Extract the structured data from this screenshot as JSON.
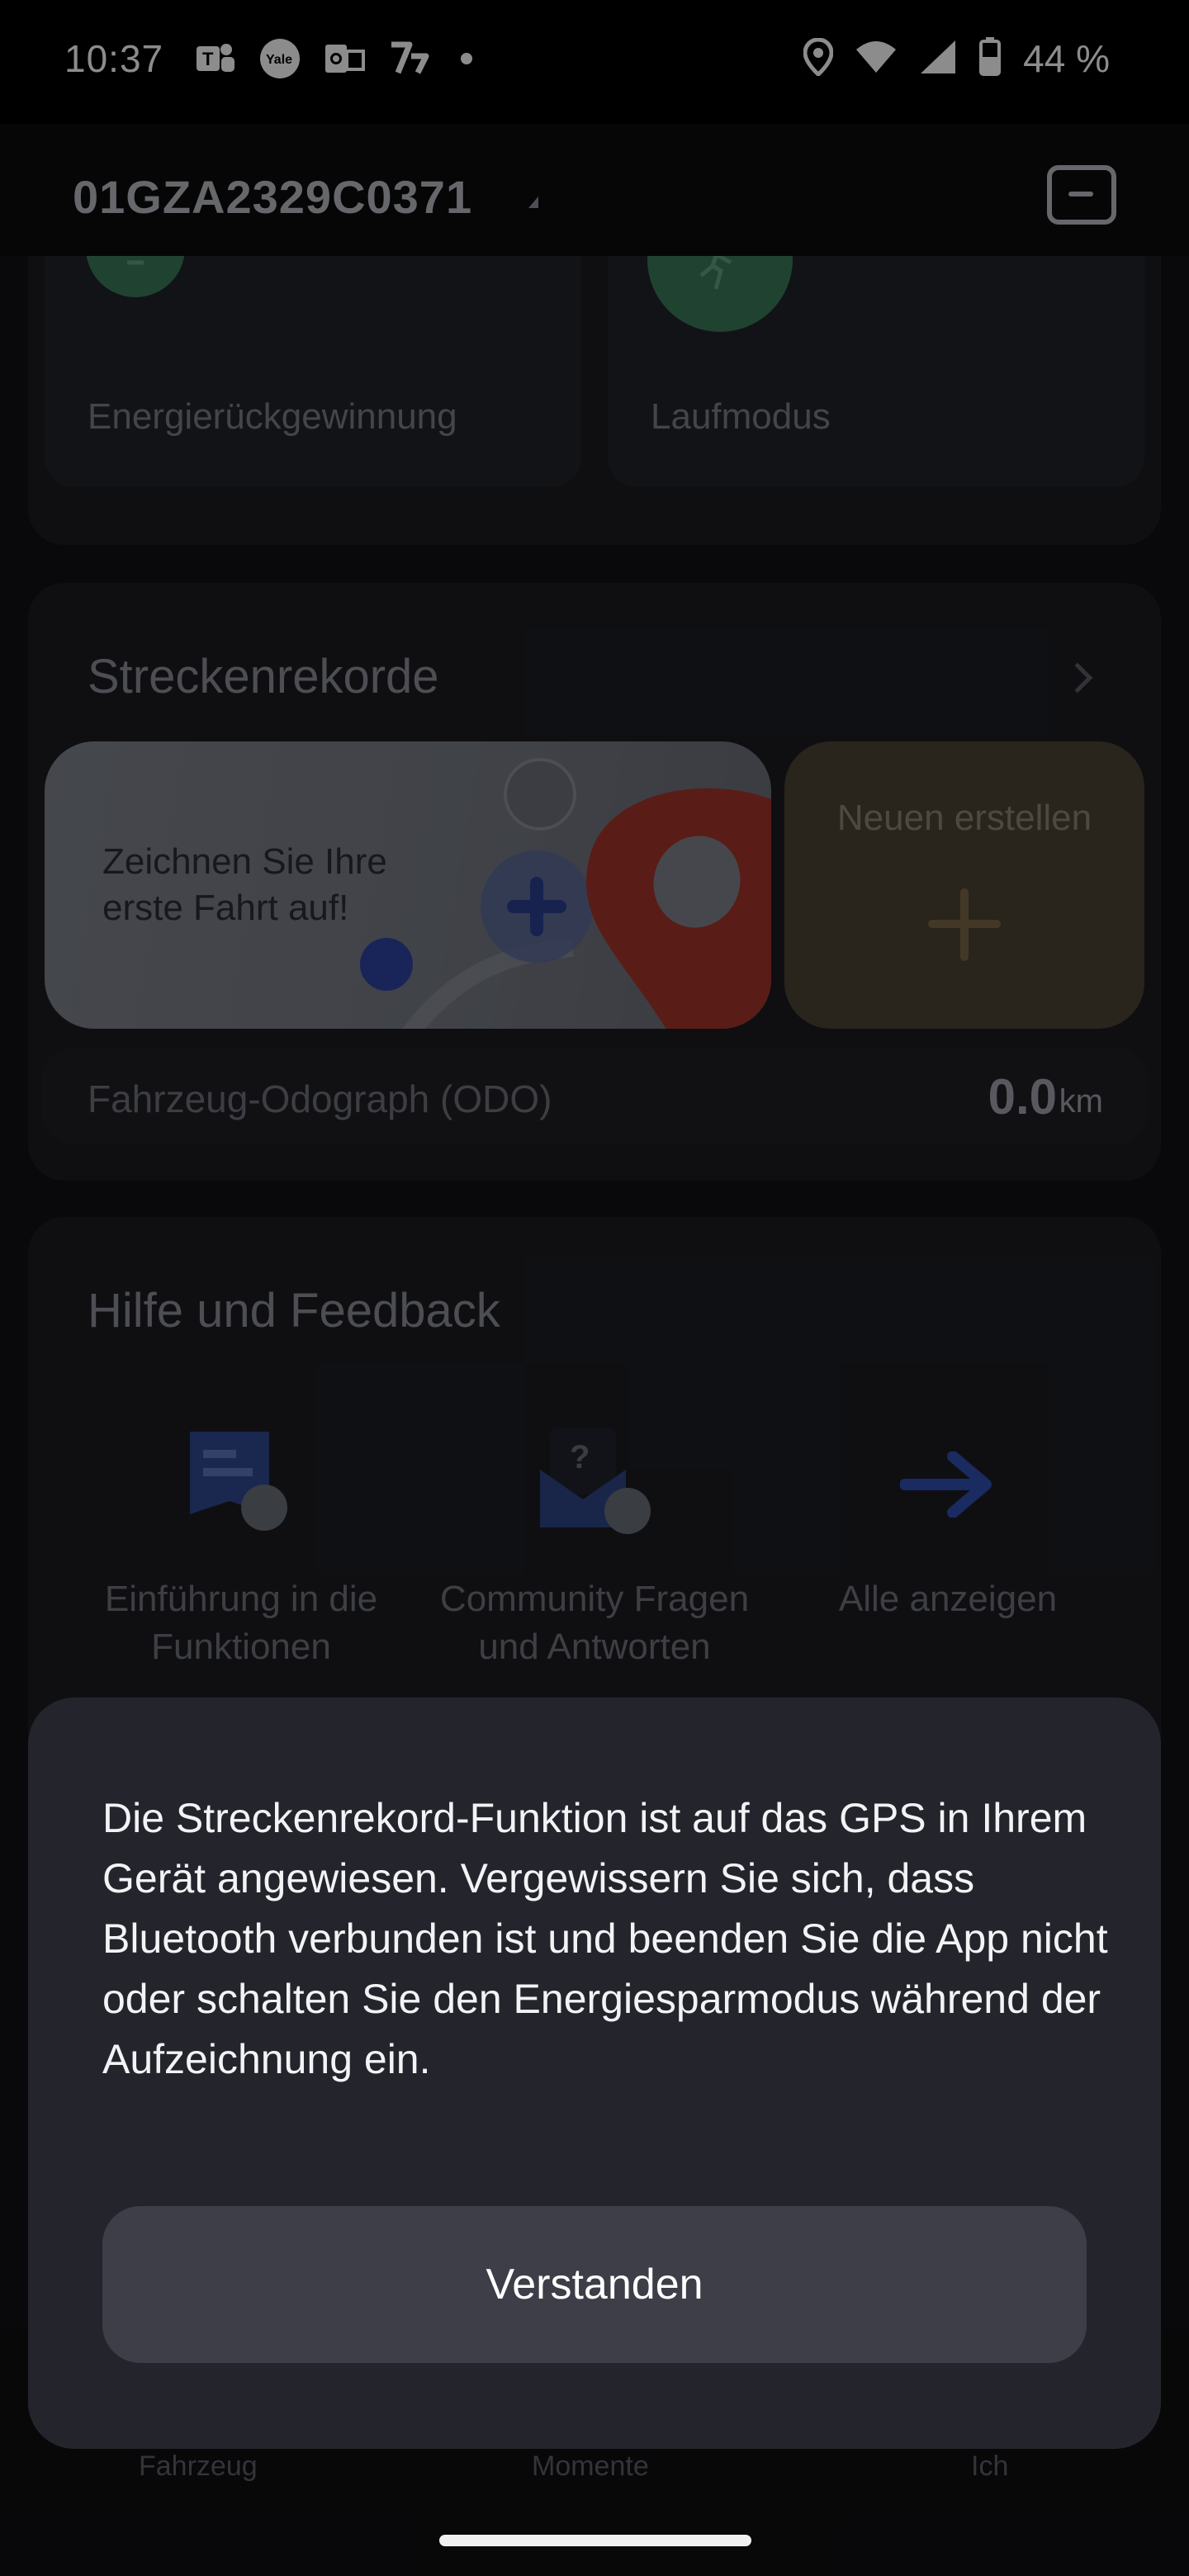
{
  "status_bar": {
    "time": "10:37",
    "battery_percent": "44 %",
    "icons_left": [
      "teams-icon",
      "yale-icon",
      "outlook-icon",
      "bolt-app-icon",
      "notification-dot"
    ],
    "icons_right": [
      "location-icon",
      "wifi-icon",
      "signal-icon",
      "battery-icon"
    ]
  },
  "header": {
    "vehicle_id": "01GZA2329C0371",
    "message_icon": "message-icon"
  },
  "top_tiles": [
    {
      "label": "Energierückgewinnung",
      "icon": "recycle-icon"
    },
    {
      "label": "Laufmodus",
      "icon": "walking-icon"
    }
  ],
  "routes": {
    "title": "Streckenrekorde",
    "record_prompt": "Zeichnen Sie Ihre erste Fahrt auf!",
    "new_label": "Neuen erstellen",
    "odo_label": "Fahrzeug-Odograph (ODO)",
    "odo_value": "0.0",
    "odo_unit": "km"
  },
  "help": {
    "title": "Hilfe und Feedback",
    "items": [
      {
        "label": "Einführung in die Funktionen",
        "icon": "document-chat-icon"
      },
      {
        "label": "Community Fragen und Antworten",
        "icon": "question-mail-icon"
      },
      {
        "label": "Alle anzeigen",
        "icon": "arrow-right-icon"
      }
    ]
  },
  "bottom_nav": {
    "items": [
      "Fahrzeug",
      "Momente",
      "Ich"
    ]
  },
  "dialog": {
    "message": "Die Streckenrekord-Funktion ist auf das GPS in Ihrem Gerät angewiesen. Vergewissern Sie sich, dass Bluetooth verbunden ist und beenden Sie die App nicht oder schalten Sie den Energiesparmodus während der Aufzeichnung ein.",
    "confirm_label": "Verstanden"
  },
  "colors": {
    "background": "#111215",
    "sheet": "#24252c",
    "button": "#3d3e47",
    "accent_green": "#3b7a5a",
    "accent_blue": "#2f4fb0",
    "accent_red": "#c0392b"
  }
}
